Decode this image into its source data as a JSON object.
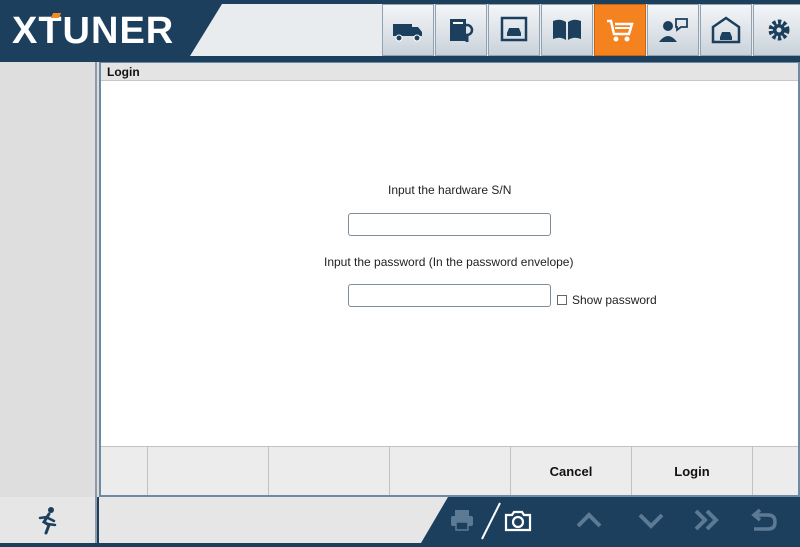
{
  "app": {
    "logo": "XTUNER"
  },
  "toolbar": {
    "buttons": [
      {
        "icon": "truck-icon",
        "active": false
      },
      {
        "icon": "book-search-icon",
        "active": false
      },
      {
        "icon": "car-photo-icon",
        "active": false
      },
      {
        "icon": "open-book-icon",
        "active": false
      },
      {
        "icon": "shopping-cart-icon",
        "active": true
      },
      {
        "icon": "user-chat-icon",
        "active": false
      },
      {
        "icon": "garage-icon",
        "active": false
      },
      {
        "icon": "gear-icon",
        "active": false
      }
    ],
    "active_color": "#f4821f"
  },
  "panel": {
    "title": "Login",
    "sn_label": "Input the hardware S/N",
    "sn_value": "",
    "password_label": "Input the password (In the password envelope)",
    "password_value": "",
    "show_password_label": "Show password",
    "show_password_checked": false
  },
  "buttons": {
    "cancel": "Cancel",
    "login": "Login"
  },
  "footer": {
    "icons": [
      "running-man-icon",
      "printer-icon",
      "camera-icon",
      "chevron-up-icon",
      "chevron-down-icon",
      "double-chevron-right-icon",
      "return-icon"
    ]
  },
  "colors": {
    "header_bg": "#1c3f5e",
    "accent": "#f4821f"
  }
}
